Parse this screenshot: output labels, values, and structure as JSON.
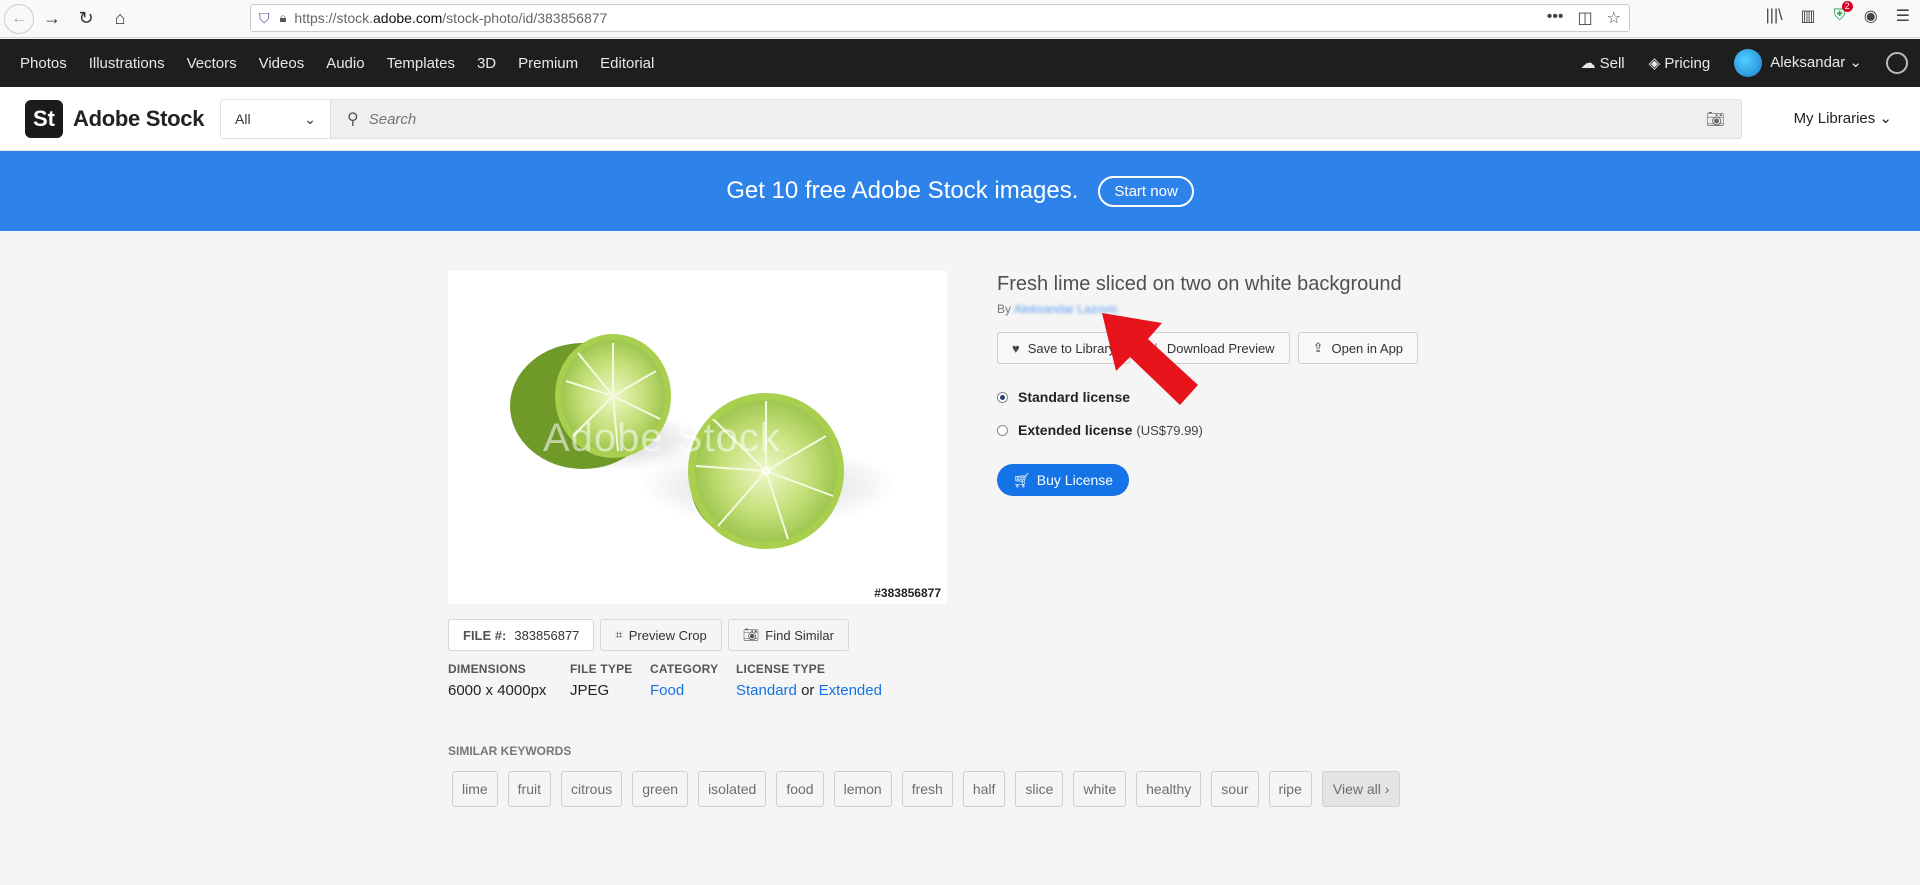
{
  "browser": {
    "url_prefix": "https://stock.",
    "url_domain": "adobe.com",
    "url_suffix": "/stock-photo/id/383856877",
    "ext_badge_count": "2"
  },
  "topnav": {
    "items": [
      "Photos",
      "Illustrations",
      "Vectors",
      "Videos",
      "Audio",
      "Templates",
      "3D",
      "Premium",
      "Editorial"
    ],
    "sell": "Sell",
    "pricing": "Pricing",
    "user": "Aleksandar"
  },
  "header": {
    "logo_mark": "St",
    "logo_text": "Adobe Stock",
    "search_filter": "All",
    "search_placeholder": "Search",
    "my_libraries": "My Libraries"
  },
  "banner": {
    "text": "Get 10 free Adobe Stock images.",
    "cta": "Start now"
  },
  "asset": {
    "watermark": "Adobe Stock",
    "image_id": "#383856877",
    "file_label": "FILE #:",
    "file_number": "383856877",
    "preview_crop": "Preview Crop",
    "find_similar": "Find Similar",
    "title": "Fresh lime sliced on two on white background",
    "by": "By",
    "author": "Aleksandar Lazovic",
    "save_to_library": "Save to Library",
    "download_preview": "Download Preview",
    "open_in_app": "Open in App",
    "standard_license": "Standard license",
    "extended_license": "Extended license",
    "extended_price": "(US$79.99)",
    "buy_license": "Buy License"
  },
  "meta": {
    "dimensions_label": "DIMENSIONS",
    "dimensions_value": "6000 x 4000px",
    "filetype_label": "FILE TYPE",
    "filetype_value": "JPEG",
    "category_label": "CATEGORY",
    "category_value": "Food",
    "license_label": "LICENSE TYPE",
    "license_standard": "Standard",
    "license_or": "or",
    "license_extended": "Extended"
  },
  "keywords": {
    "label": "SIMILAR KEYWORDS",
    "items": [
      "lime",
      "fruit",
      "citrous",
      "green",
      "isolated",
      "food",
      "lemon",
      "fresh",
      "half",
      "slice",
      "white",
      "healthy",
      "sour",
      "ripe"
    ],
    "view_all": "View all ›"
  },
  "colors": {
    "accent": "#1473e6",
    "banner": "#2d83ea",
    "topnav": "#1e1e1e",
    "arrow": "#e8141c"
  }
}
